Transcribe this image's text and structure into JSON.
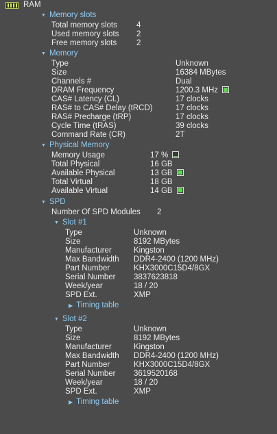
{
  "root_label": "RAM",
  "memory_slots": {
    "title": "Memory slots",
    "rows": [
      {
        "label": "Total memory slots",
        "value": "4"
      },
      {
        "label": "Used memory slots",
        "value": "2"
      },
      {
        "label": "Free memory slots",
        "value": "2"
      }
    ]
  },
  "memory": {
    "title": "Memory",
    "rows": [
      {
        "label": "Type",
        "value": "Unknown"
      },
      {
        "label": "Size",
        "value": "16384 MBytes"
      },
      {
        "label": "Channels #",
        "value": "Dual"
      },
      {
        "label": "DRAM Frequency",
        "value": "1200.3 MHz",
        "gauge_level": 0.95
      },
      {
        "label": "CAS# Latency (CL)",
        "value": "17 clocks"
      },
      {
        "label": "RAS# to CAS# Delay (tRCD)",
        "value": "17 clocks"
      },
      {
        "label": "RAS# Precharge (tRP)",
        "value": "17 clocks"
      },
      {
        "label": "Cycle Time (tRAS)",
        "value": "39 clocks"
      },
      {
        "label": "Command Rate (CR)",
        "value": "2T"
      }
    ]
  },
  "physical_memory": {
    "title": "Physical Memory",
    "rows": [
      {
        "label": "Memory Usage",
        "value": "17 %",
        "gauge_level": 0.17
      },
      {
        "label": "Total Physical",
        "value": "16 GB"
      },
      {
        "label": "Available Physical",
        "value": "13 GB",
        "gauge_level": 0.95
      },
      {
        "label": "Total Virtual",
        "value": "18 GB"
      },
      {
        "label": "Available Virtual",
        "value": "14 GB",
        "gauge_level": 0.95
      }
    ]
  },
  "spd": {
    "title": "SPD",
    "modules_label": "Number Of SPD Modules",
    "modules_value": "2",
    "slots": [
      {
        "title": "Slot #1",
        "rows": [
          {
            "label": "Type",
            "value": "Unknown"
          },
          {
            "label": "Size",
            "value": "8192 MBytes"
          },
          {
            "label": "Manufacturer",
            "value": "Kingston"
          },
          {
            "label": "Max Bandwidth",
            "value": "DDR4-2400 (1200 MHz)"
          },
          {
            "label": "Part Number",
            "value": "KHX3000C15D4/8GX"
          },
          {
            "label": "Serial Number",
            "value": "3837623818"
          },
          {
            "label": "Week/year",
            "value": "18 / 20"
          },
          {
            "label": "SPD Ext.",
            "value": "XMP"
          }
        ],
        "timing_label": "Timing table"
      },
      {
        "title": "Slot #2",
        "rows": [
          {
            "label": "Type",
            "value": "Unknown"
          },
          {
            "label": "Size",
            "value": "8192 MBytes"
          },
          {
            "label": "Manufacturer",
            "value": "Kingston"
          },
          {
            "label": "Max Bandwidth",
            "value": "DDR4-2400 (1200 MHz)"
          },
          {
            "label": "Part Number",
            "value": "KHX3000C15D4/8GX"
          },
          {
            "label": "Serial Number",
            "value": "3619520168"
          },
          {
            "label": "Week/year",
            "value": "18 / 20"
          },
          {
            "label": "SPD Ext.",
            "value": "XMP"
          }
        ],
        "timing_label": "Timing table"
      }
    ]
  },
  "colors": {
    "background": "#4b4b4b",
    "text": "#ececec",
    "section": "#8ecbf3",
    "gauge_fill": "#5cdc4c"
  },
  "icons": {
    "root": "ram-chip-icon",
    "expanded": "expanded-arrow-icon",
    "collapsed": "collapsed-arrow-icon"
  }
}
